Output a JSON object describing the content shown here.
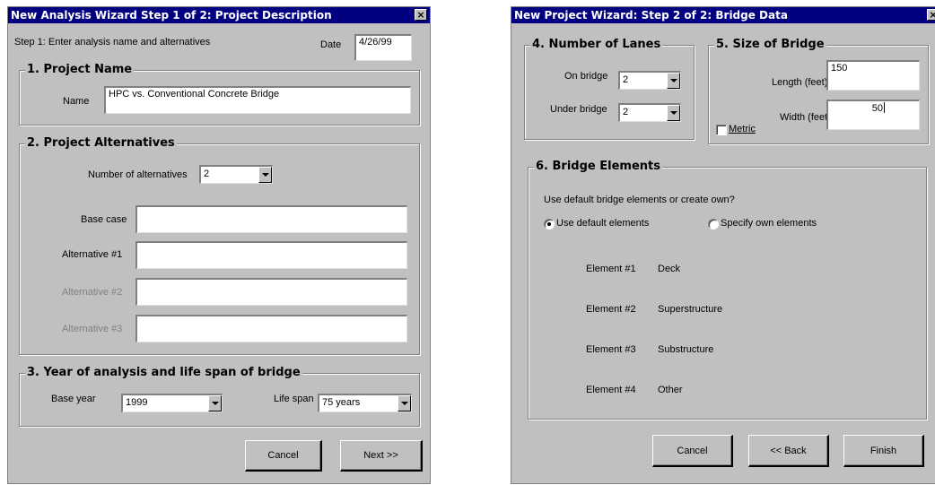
{
  "left": {
    "title": "New Analysis Wizard Step 1 of 2: Project Description",
    "close_glyph": "×",
    "instruction": "Step 1: Enter analysis name and alternatives",
    "date_label": "Date",
    "date_value": "4/26/99",
    "project_name": {
      "title": "1. Project Name",
      "name_label": "Name",
      "name_value": "HPC vs. Conventional Concrete Bridge"
    },
    "alternatives": {
      "title": "2. Project Alternatives",
      "count_label": "Number of alternatives",
      "count_value": "2",
      "rows": [
        {
          "label": "Base case",
          "value": ""
        },
        {
          "label": "Alternative #1",
          "value": ""
        },
        {
          "label": "Alternative #2",
          "value": ""
        },
        {
          "label": "Alternative #3",
          "value": ""
        }
      ]
    },
    "years": {
      "title": "3. Year of analysis and life span of bridge",
      "base_year_label": "Base year",
      "base_year_value": "1999",
      "life_span_label": "Life span",
      "life_span_value": "75 years"
    },
    "buttons": {
      "cancel": "Cancel",
      "next": "Next >>"
    }
  },
  "right": {
    "title": "New Project Wizard: Step 2 of 2: Bridge Data",
    "close_glyph": "×",
    "lanes": {
      "title": "4. Number of Lanes",
      "on_label": "On bridge",
      "on_value": "2",
      "under_label": "Under bridge",
      "under_value": "2"
    },
    "size": {
      "title": "5. Size of Bridge",
      "length_label": "Length (feet)",
      "length_value": "150",
      "width_label": "Width (feet)",
      "width_value": "50",
      "metric_label": "Metric"
    },
    "elements": {
      "title": "6. Bridge Elements",
      "question": "Use default bridge elements or create own?",
      "opt_default": "Use default elements",
      "opt_own": "Specify own elements",
      "list": [
        {
          "label": "Element #1",
          "value": "Deck"
        },
        {
          "label": "Element #2",
          "value": "Superstructure"
        },
        {
          "label": "Element #3",
          "value": "Substructure"
        },
        {
          "label": "Element #4",
          "value": "Other"
        }
      ]
    },
    "buttons": {
      "cancel": "Cancel",
      "back": "<< Back",
      "finish": "Finish"
    }
  }
}
